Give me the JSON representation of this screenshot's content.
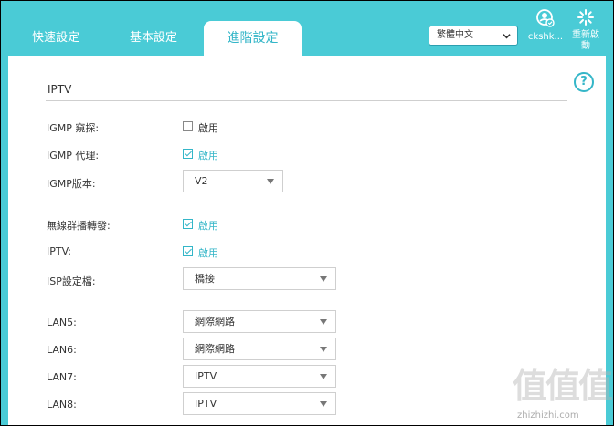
{
  "tabs": {
    "quick": "快速設定",
    "basic": "基本設定",
    "advanced": "進階設定"
  },
  "language": {
    "selected": "繁體中文"
  },
  "user": {
    "name": "ckshk..."
  },
  "reboot": {
    "label_line1": "重新啟",
    "label_line2": "動"
  },
  "section": {
    "title": "IPTV"
  },
  "fields": {
    "igmp_snooping": {
      "label": "IGMP 窺探:",
      "check_label": "啟用",
      "checked": false
    },
    "igmp_proxy": {
      "label": "IGMP 代理:",
      "check_label": "啟用",
      "checked": true
    },
    "igmp_version": {
      "label": "IGMP版本:",
      "value": "V2"
    },
    "wireless_multicast": {
      "label": "無線群播轉發:",
      "check_label": "啟用",
      "checked": true
    },
    "iptv": {
      "label": "IPTV:",
      "check_label": "啟用",
      "checked": true
    },
    "isp_profile": {
      "label": "ISP設定檔:",
      "value": "橋接"
    },
    "lan5": {
      "label": "LAN5:",
      "value": "網際網路"
    },
    "lan6": {
      "label": "LAN6:",
      "value": "網際網路"
    },
    "lan7": {
      "label": "LAN7:",
      "value": "IPTV"
    },
    "lan8": {
      "label": "LAN8:",
      "value": "IPTV"
    }
  },
  "watermark": {
    "text": "值值值",
    "url": "zhizhizhi.com"
  },
  "colors": {
    "accent": "#4acbd6",
    "accent_dark": "#34b6c8"
  }
}
